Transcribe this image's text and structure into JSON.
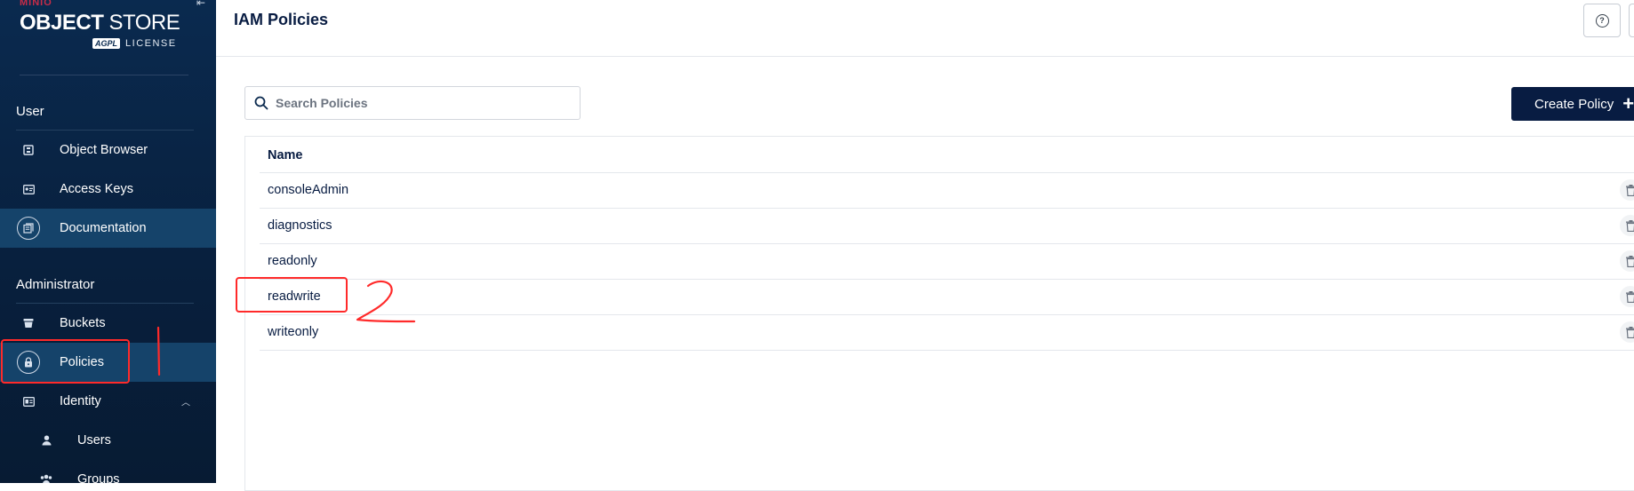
{
  "sidebar": {
    "logo": {
      "brand": "MINIO",
      "title_bold": "OBJECT",
      "title_rest": " STORE",
      "agpl": "AGPL",
      "license": "LICENSE"
    },
    "sections": [
      {
        "title": "User",
        "items": [
          {
            "label": "Object Browser",
            "icon": "object-browser-icon",
            "active": false
          },
          {
            "label": "Access Keys",
            "icon": "access-keys-icon",
            "active": false
          },
          {
            "label": "Documentation",
            "icon": "documentation-icon",
            "active": true
          }
        ]
      },
      {
        "title": "Administrator",
        "items": [
          {
            "label": "Buckets",
            "icon": "bucket-icon",
            "active": false
          },
          {
            "label": "Policies",
            "icon": "lock-icon",
            "active": true
          },
          {
            "label": "Identity",
            "icon": "identity-icon",
            "active": false,
            "expanded": true
          },
          {
            "label": "Users",
            "icon": "user-icon",
            "active": false,
            "sub": true
          },
          {
            "label": "Groups",
            "icon": "groups-icon",
            "active": false,
            "sub": true
          }
        ]
      }
    ]
  },
  "header": {
    "title": "IAM Policies"
  },
  "search": {
    "placeholder": "Search Policies",
    "value": ""
  },
  "toolbar": {
    "create_label": "Create Policy"
  },
  "table": {
    "column": "Name",
    "rows": [
      "consoleAdmin",
      "diagnostics",
      "readonly",
      "readwrite",
      "writeonly"
    ]
  },
  "annotations": {
    "color": "#ff2a2a"
  }
}
